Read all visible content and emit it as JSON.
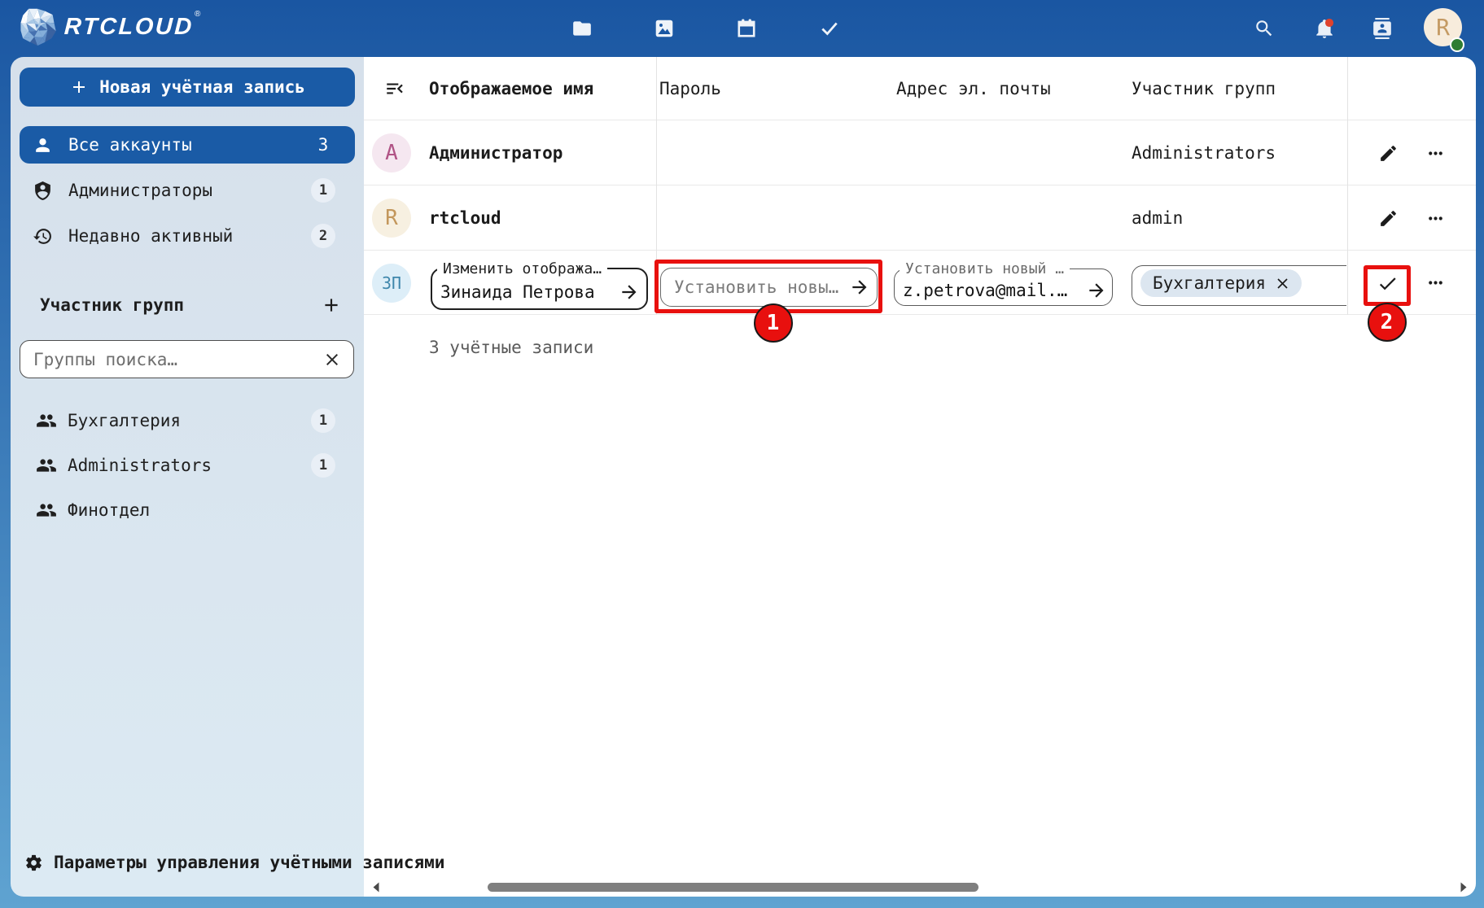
{
  "colors": {
    "primary": "#1a5ba6",
    "bg-top": "#1a56a2",
    "bg-bottom": "#5fa3d1",
    "ann": "#e8100e",
    "alert": "#e0422d"
  },
  "brand": {
    "name": "RTCLOUD",
    "registered": "®"
  },
  "header": {
    "app_icons": [
      "files",
      "photos",
      "calendar",
      "tasks"
    ],
    "right_icons": [
      "search",
      "notifications",
      "contacts"
    ],
    "avatar": {
      "initial": "R",
      "status": "online"
    }
  },
  "sidebar": {
    "new_account_label": "Новая учётная запись",
    "nav": [
      {
        "label": "Все аккаунты",
        "count": "3",
        "selected": true
      },
      {
        "label": "Администраторы",
        "count": "1",
        "selected": false
      },
      {
        "label": "Недавно активный",
        "count": "2",
        "selected": false
      }
    ],
    "groups_section": {
      "title": "Участник групп",
      "add_icon": "plus"
    },
    "search": {
      "placeholder": "Группы поиска…"
    },
    "groups": [
      {
        "label": "Бухгалтерия",
        "count": "1"
      },
      {
        "label": "Administrators",
        "count": "1"
      },
      {
        "label": "Финотдел",
        "count": ""
      }
    ],
    "footer_label": "Параметры управления учётными записями"
  },
  "table": {
    "columns": {
      "displayname": "Отображаемое имя",
      "password": "Пароль",
      "email": "Адрес эл. почты",
      "groups": "Участник групп"
    },
    "rows": [
      {
        "initial": "A",
        "avatar_bg": "#f5e7f0",
        "avatar_fg": "#b05385",
        "displayname": "Администратор",
        "groups": "Administrators"
      },
      {
        "initial": "R",
        "avatar_bg": "#f7f0e1",
        "avatar_fg": "#c3975c",
        "displayname": "rtcloud",
        "groups": "admin"
      }
    ],
    "edit_row": {
      "initial": "ЗП",
      "avatar_bg": "#ddeef8",
      "avatar_fg": "#3f87ac",
      "displayname_label": "Изменить отобража…",
      "displayname_value": "Зинаида Петрова",
      "password_placeholder": "Установить новы…",
      "email_label": "Установить новый …",
      "email_value": "z.petrova@mail.…",
      "group_chip": "Бухгалтерия"
    },
    "summary": "3 учётные записи"
  },
  "annotations": {
    "first": "1",
    "second": "2"
  }
}
